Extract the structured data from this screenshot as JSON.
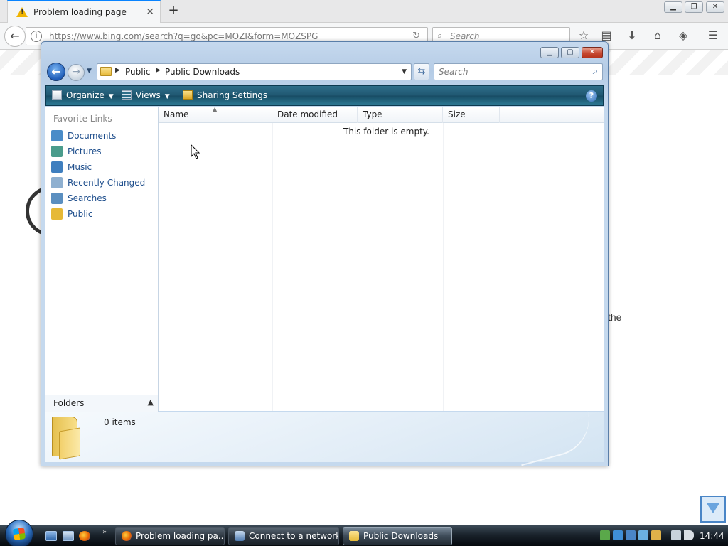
{
  "browser": {
    "tab_title": "Problem loading page",
    "url": "https://www.bing.com/search?q=go&pc=MOZI&form=MOZSPG",
    "search_placeholder": "Search",
    "page_fragment_text": "the"
  },
  "explorer": {
    "breadcrumb": [
      "Public",
      "Public Downloads"
    ],
    "search_placeholder": "Search",
    "toolbar": {
      "organize": "Organize",
      "views": "Views",
      "sharing": "Sharing Settings"
    },
    "nav": {
      "header": "Favorite Links",
      "links": [
        {
          "label": "Documents",
          "icon": "documents-icon",
          "color": "#4a8cc8"
        },
        {
          "label": "Pictures",
          "icon": "pictures-icon",
          "color": "#4a9c8c"
        },
        {
          "label": "Music",
          "icon": "music-icon",
          "color": "#3f7fbf"
        },
        {
          "label": "Recently Changed",
          "icon": "recently-changed-icon",
          "color": "#8fb0d0"
        },
        {
          "label": "Searches",
          "icon": "searches-icon",
          "color": "#5b8fc0"
        },
        {
          "label": "Public",
          "icon": "public-folder-icon",
          "color": "#e6b937"
        }
      ],
      "folders_label": "Folders"
    },
    "columns": [
      "Name",
      "Date modified",
      "Type",
      "Size"
    ],
    "empty_message": "This folder is empty.",
    "item_count": "0 items"
  },
  "taskbar": {
    "buttons": [
      {
        "label": "Problem loading pa...",
        "icon": "firefox-icon"
      },
      {
        "label": "Connect to a network",
        "icon": "network-icon"
      },
      {
        "label": "Public Downloads",
        "icon": "folder-icon"
      }
    ],
    "clock": "14:44"
  }
}
